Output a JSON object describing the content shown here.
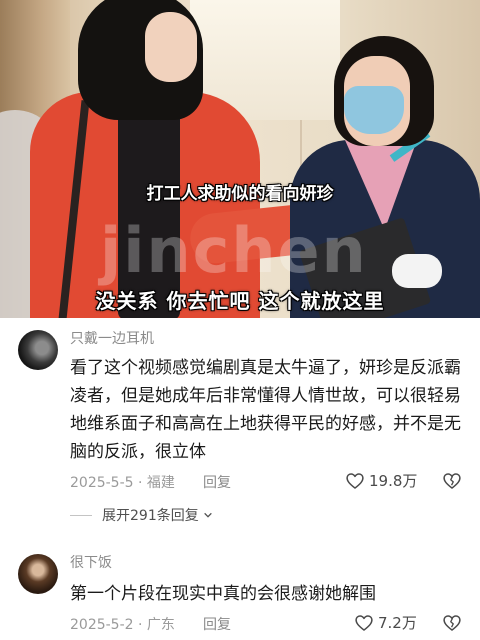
{
  "video": {
    "subtitle_top": "打工人求助似的看向妍珍",
    "subtitle_bottom": "没关系 你去忙吧 这个就放这里",
    "watermark": "jinchen"
  },
  "comments": [
    {
      "username": "只戴一边耳机",
      "text": "看了这个视频感觉编剧真是太牛逼了，妍珍是反派霸凌者，但是她成年后非常懂得人情世故，可以很轻易地维系面子和高高在上地获得平民的好感，并不是无脑的反派，很立体",
      "date_location": "2025-5-5 · 福建",
      "reply_label": "回复",
      "likes": "19.8万",
      "expand_label": "展开291条回复"
    },
    {
      "username": "很下饭",
      "text": "第一个片段在现实中真的会很感谢她解围",
      "date_location": "2025-5-2 · 广东",
      "reply_label": "回复",
      "likes": "7.2万"
    }
  ],
  "icons": {
    "like": "heart-outline-icon",
    "dislike": "broken-heart-icon",
    "expand": "chevron-down-icon"
  }
}
